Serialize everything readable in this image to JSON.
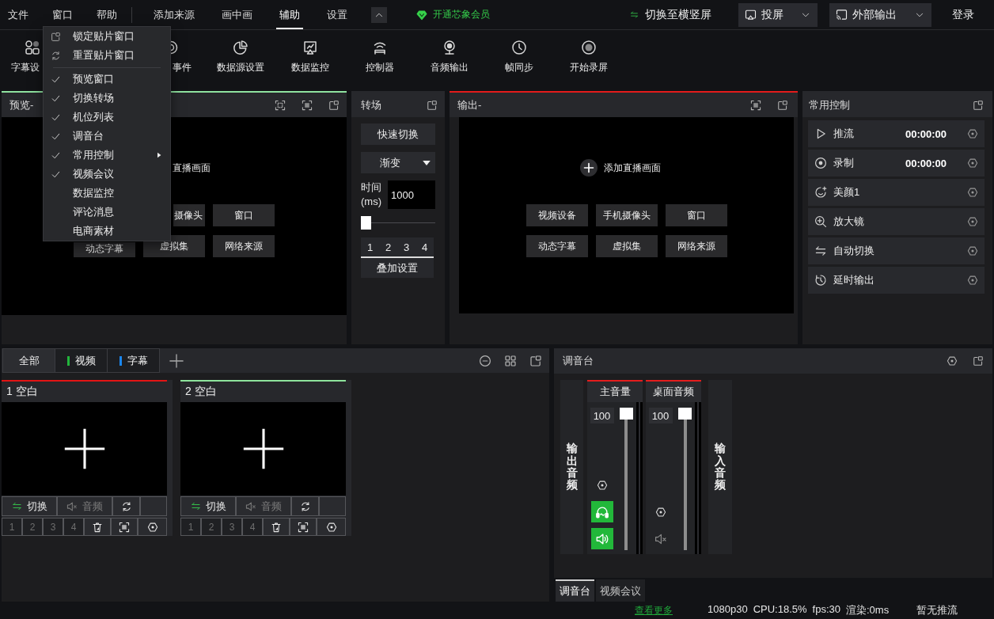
{
  "menubar": {
    "menus": [
      {
        "label": "文件"
      },
      {
        "label": "窗口"
      },
      {
        "label": "帮助"
      }
    ],
    "tabs": [
      {
        "label": "添加来源",
        "selected": false
      },
      {
        "label": "画中画",
        "selected": false
      },
      {
        "label": "辅助",
        "selected": true
      },
      {
        "label": "设置",
        "selected": false
      }
    ],
    "vip_label": "开通芯象会员",
    "orientation_label": "切换至横竖屏",
    "dropdowns": [
      {
        "label": "投屏"
      },
      {
        "label": "外部输出"
      }
    ],
    "login_label": "登录"
  },
  "window_menu": {
    "items": [
      {
        "kind": "action",
        "label": "锁定贴片窗口",
        "submenu": false
      },
      {
        "kind": "action",
        "label": "重置贴片窗口",
        "submenu": false
      },
      {
        "kind": "check",
        "label": "预览窗口",
        "checked": true,
        "submenu": false
      },
      {
        "kind": "check",
        "label": "切换转场",
        "checked": true,
        "submenu": false
      },
      {
        "kind": "check",
        "label": "机位列表",
        "checked": true,
        "submenu": false
      },
      {
        "kind": "check",
        "label": "调音台",
        "checked": true,
        "submenu": false
      },
      {
        "kind": "check",
        "label": "常用控制",
        "checked": true,
        "submenu": true
      },
      {
        "kind": "check",
        "label": "视频会议",
        "checked": true,
        "submenu": false
      },
      {
        "kind": "check",
        "label": "数据监控",
        "checked": false,
        "submenu": false
      },
      {
        "kind": "check",
        "label": "评论消息",
        "checked": false,
        "submenu": false
      },
      {
        "kind": "check",
        "label": "电商素材",
        "checked": false,
        "submenu": false
      }
    ]
  },
  "toolbar": [
    {
      "label": "字幕设"
    },
    {
      "label": "事件"
    },
    {
      "label": "数据源设置"
    },
    {
      "label": "数据监控"
    },
    {
      "label": "控制器"
    },
    {
      "label": "音频输出"
    },
    {
      "label": "帧同步"
    },
    {
      "label": "开始录屏"
    }
  ],
  "preview": {
    "title": "预览-",
    "add_label": "直播画面",
    "buttons": [
      {
        "label": "摄像头"
      },
      {
        "label": "窗口"
      },
      {
        "label": "动态字幕"
      },
      {
        "label": "虚拟集"
      },
      {
        "label": "网络来源"
      }
    ]
  },
  "transition": {
    "title": "转场",
    "quick_button": "快速切换",
    "effect": "渐变",
    "time_label": "时间 (ms)",
    "time_value": "1000",
    "duration_slider": {
      "level": 0
    },
    "slots": [
      {
        "label": "1"
      },
      {
        "label": "2"
      },
      {
        "label": "3"
      },
      {
        "label": "4"
      }
    ],
    "overlay_button": "叠加设置"
  },
  "output": {
    "title": "输出-",
    "add_label": "添加直播画面",
    "buttons": [
      {
        "label": "视频设备"
      },
      {
        "label": "手机摄像头"
      },
      {
        "label": "窗口"
      },
      {
        "label": "动态字幕"
      },
      {
        "label": "虚拟集"
      },
      {
        "label": "网络来源"
      }
    ]
  },
  "common_controls": {
    "title": "常用控制",
    "items": [
      {
        "label": "推流",
        "time": "00:00:00"
      },
      {
        "label": "录制",
        "time": "00:00:00"
      },
      {
        "label": "美颜1"
      },
      {
        "label": "放大镜"
      },
      {
        "label": "自动切换"
      },
      {
        "label": "延时输出"
      }
    ]
  },
  "scenes": {
    "filters": [
      {
        "label": "全部",
        "selected": true
      },
      {
        "label": "视频",
        "selected": false,
        "color": "#22b53c"
      },
      {
        "label": "字幕",
        "selected": false,
        "color": "#1a86ee"
      }
    ],
    "cards": [
      {
        "title": "1 空白",
        "color": "#e31414",
        "switch_label": "切换",
        "audio_label": "音频",
        "audio_muted": true,
        "slots": [
          {
            "label": "1",
            "selected": false
          },
          {
            "label": "2",
            "selected": false
          },
          {
            "label": "3",
            "selected": false
          },
          {
            "label": "4",
            "selected": false
          }
        ]
      },
      {
        "title": "2 空白",
        "color": "#8ee49c",
        "switch_label": "切换",
        "audio_label": "音频",
        "audio_muted": true,
        "slots": [
          {
            "label": "1",
            "selected": false
          },
          {
            "label": "2",
            "selected": false
          },
          {
            "label": "3",
            "selected": false
          },
          {
            "label": "4",
            "selected": false
          }
        ]
      }
    ]
  },
  "mixer": {
    "title": "调音台",
    "output_label": "输出音频",
    "input_label": "输入音频",
    "channels": [
      {
        "kind": "master",
        "name": "主音量",
        "value": "100",
        "level": 1,
        "monitor": true,
        "muted": false
      },
      {
        "kind": "source",
        "name": "桌面音频",
        "value": "100",
        "level": 1,
        "muted": true
      }
    ],
    "tabs": [
      {
        "label": "调音台",
        "selected": true
      },
      {
        "label": "视频会议",
        "selected": false
      }
    ]
  },
  "status_bar": {
    "link": "查看更多",
    "stats": [
      "1080p30",
      "CPU:18.5%",
      "fps:30",
      "渲染:0ms"
    ],
    "stream_status": "暂无推流"
  }
}
